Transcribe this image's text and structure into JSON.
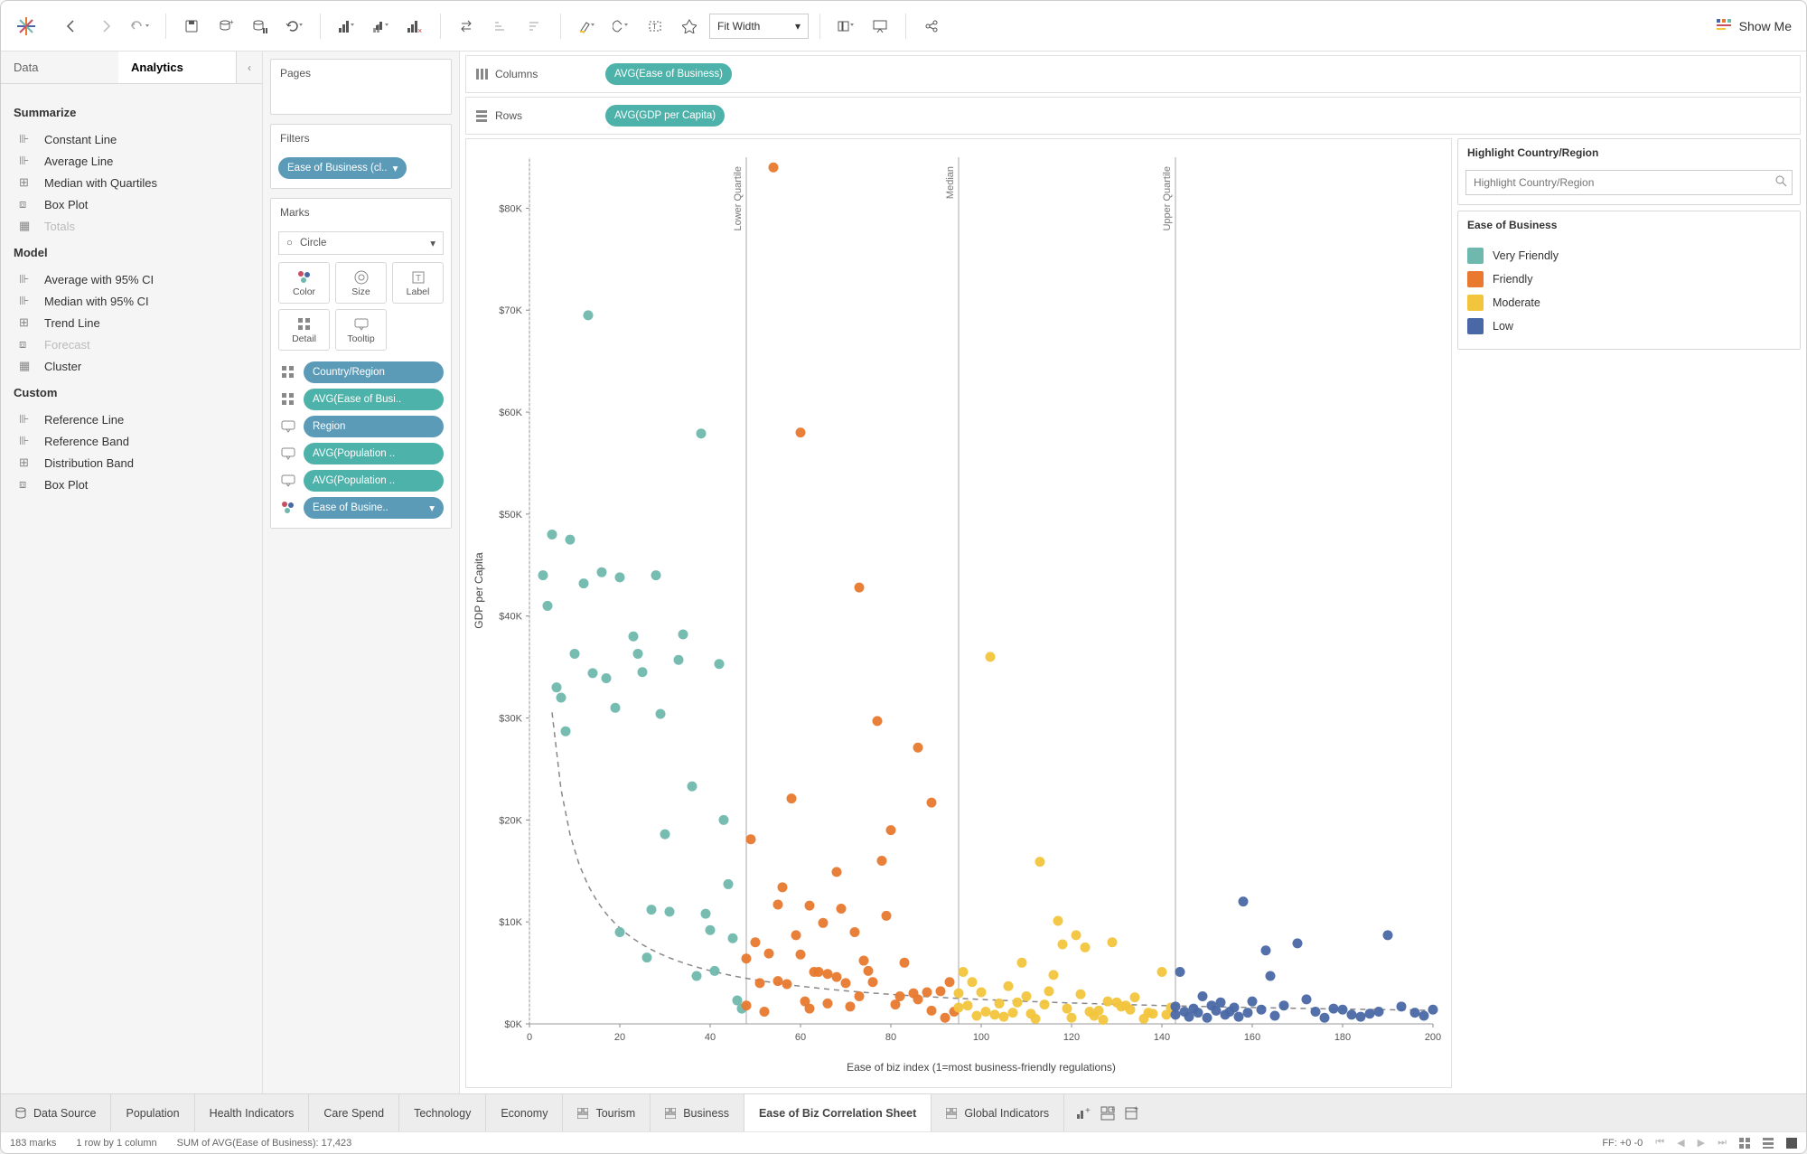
{
  "toolbar": {
    "fit_label": "Fit Width",
    "showme_label": "Show Me"
  },
  "sidebar": {
    "tabs": {
      "data": "Data",
      "analytics": "Analytics"
    },
    "summarize": {
      "heading": "Summarize",
      "items": [
        "Constant Line",
        "Average Line",
        "Median with Quartiles",
        "Box Plot",
        "Totals"
      ]
    },
    "model": {
      "heading": "Model",
      "items": [
        "Average with 95% CI",
        "Median with 95% CI",
        "Trend Line",
        "Forecast",
        "Cluster"
      ]
    },
    "custom": {
      "heading": "Custom",
      "items": [
        "Reference Line",
        "Reference Band",
        "Distribution Band",
        "Box Plot"
      ]
    }
  },
  "mid": {
    "pages": "Pages",
    "filters": "Filters",
    "filters_pill": "Ease of Business (cl..",
    "marks": "Marks",
    "mark_type": "Circle",
    "mark_btns": [
      "Color",
      "Size",
      "Label",
      "Detail",
      "Tooltip"
    ],
    "mark_pills": [
      {
        "pill": "Country/Region",
        "color": "blue",
        "slot": "detail"
      },
      {
        "pill": "AVG(Ease of Busi..",
        "color": "teal",
        "slot": "detail"
      },
      {
        "pill": "Region",
        "color": "blue",
        "slot": "tooltip"
      },
      {
        "pill": "AVG(Population ..",
        "color": "teal",
        "slot": "tooltip"
      },
      {
        "pill": "AVG(Population ..",
        "color": "teal",
        "slot": "tooltip"
      },
      {
        "pill": "Ease of Busine..",
        "color": "blue",
        "slot": "color"
      }
    ]
  },
  "shelves": {
    "columns_label": "Columns",
    "columns_pill": "AVG(Ease of Business)",
    "rows_label": "Rows",
    "rows_pill": "AVG(GDP per Capita)"
  },
  "right": {
    "highlight_heading": "Highlight Country/Region",
    "highlight_placeholder": "Highlight Country/Region",
    "legend_heading": "Ease of Business",
    "legend_items": [
      {
        "label": "Very Friendly",
        "color": "#6fb8ad"
      },
      {
        "label": "Friendly",
        "color": "#e8792e"
      },
      {
        "label": "Moderate",
        "color": "#f2c53d"
      },
      {
        "label": "Low",
        "color": "#4a68a5"
      }
    ]
  },
  "tabs": {
    "data_source": "Data Source",
    "items": [
      "Population",
      "Health Indicators",
      "Care Spend",
      "Technology",
      "Economy",
      "Tourism",
      "Business",
      "Ease of Biz Correlation Sheet",
      "Global Indicators"
    ],
    "active": "Ease of Biz Correlation Sheet"
  },
  "status": {
    "marks": "183 marks",
    "dims": "1 row by 1 column",
    "sum": "SUM of AVG(Ease of Business): 17,423",
    "ff": "FF: +0 -0"
  },
  "chart_data": {
    "type": "scatter",
    "xlabel": "Ease of biz index (1=most business-friendly regulations)",
    "ylabel": "GDP per Capita",
    "xlim": [
      0,
      200
    ],
    "ylim": [
      0,
      85000
    ],
    "xticks": [
      0,
      20,
      40,
      60,
      80,
      100,
      120,
      140,
      160,
      180,
      200
    ],
    "yticks": [
      "$0K",
      "$10K",
      "$20K",
      "$30K",
      "$40K",
      "$50K",
      "$60K",
      "$70K",
      "$80K"
    ],
    "reference_lines": [
      {
        "label": "Lower Quartile",
        "x": 48
      },
      {
        "label": "Median",
        "x": 95
      },
      {
        "label": "Upper Quartile",
        "x": 143
      }
    ],
    "colors": {
      "Very Friendly": "#6fb8ad",
      "Friendly": "#e8792e",
      "Moderate": "#f2c53d",
      "Low": "#4a68a5"
    },
    "series": [
      {
        "name": "Very Friendly",
        "points": [
          [
            3,
            44000
          ],
          [
            4,
            41000
          ],
          [
            5,
            48000
          ],
          [
            6,
            33000
          ],
          [
            7,
            32000
          ],
          [
            8,
            28700
          ],
          [
            9,
            47500
          ],
          [
            10,
            36300
          ],
          [
            12,
            43200
          ],
          [
            13,
            69500
          ],
          [
            14,
            34400
          ],
          [
            16,
            44300
          ],
          [
            17,
            33900
          ],
          [
            20,
            43800
          ],
          [
            19,
            31000
          ],
          [
            20,
            9000
          ],
          [
            23,
            38000
          ],
          [
            24,
            36300
          ],
          [
            25,
            34500
          ],
          [
            26,
            6500
          ],
          [
            27,
            11200
          ],
          [
            28,
            44000
          ],
          [
            29,
            30400
          ],
          [
            30,
            18600
          ],
          [
            31,
            11000
          ],
          [
            33,
            35700
          ],
          [
            34,
            38200
          ],
          [
            36,
            23300
          ],
          [
            37,
            4700
          ],
          [
            38,
            57900
          ],
          [
            39,
            10800
          ],
          [
            40,
            9200
          ],
          [
            41,
            5200
          ],
          [
            42,
            35300
          ],
          [
            43,
            20000
          ],
          [
            44,
            13700
          ],
          [
            45,
            8400
          ],
          [
            46,
            2300
          ],
          [
            47,
            1500
          ]
        ]
      },
      {
        "name": "Friendly",
        "points": [
          [
            48,
            1800
          ],
          [
            48,
            6400
          ],
          [
            49,
            18100
          ],
          [
            50,
            8000
          ],
          [
            51,
            4000
          ],
          [
            52,
            1200
          ],
          [
            53,
            6900
          ],
          [
            54,
            84000
          ],
          [
            55,
            4200
          ],
          [
            55,
            11700
          ],
          [
            56,
            13400
          ],
          [
            57,
            3900
          ],
          [
            58,
            22100
          ],
          [
            59,
            8700
          ],
          [
            60,
            6800
          ],
          [
            60,
            58000
          ],
          [
            61,
            2200
          ],
          [
            62,
            11600
          ],
          [
            62,
            1500
          ],
          [
            63,
            5100
          ],
          [
            64,
            5100
          ],
          [
            65,
            9900
          ],
          [
            66,
            4900
          ],
          [
            66,
            2000
          ],
          [
            68,
            14900
          ],
          [
            68,
            4600
          ],
          [
            69,
            11300
          ],
          [
            70,
            4000
          ],
          [
            71,
            1700
          ],
          [
            72,
            9000
          ],
          [
            73,
            2700
          ],
          [
            73,
            42800
          ],
          [
            74,
            6200
          ],
          [
            75,
            5200
          ],
          [
            76,
            4100
          ],
          [
            77,
            29700
          ],
          [
            78,
            16000
          ],
          [
            79,
            10600
          ],
          [
            80,
            19000
          ],
          [
            81,
            1900
          ],
          [
            82,
            2700
          ],
          [
            83,
            6000
          ],
          [
            85,
            3000
          ],
          [
            86,
            27100
          ],
          [
            86,
            2400
          ],
          [
            88,
            3100
          ],
          [
            89,
            21700
          ],
          [
            89,
            1300
          ],
          [
            91,
            3200
          ],
          [
            92,
            600
          ],
          [
            93,
            4100
          ],
          [
            94,
            1200
          ]
        ]
      },
      {
        "name": "Moderate",
        "points": [
          [
            95,
            3000
          ],
          [
            95,
            1600
          ],
          [
            96,
            5100
          ],
          [
            97,
            1800
          ],
          [
            98,
            4100
          ],
          [
            99,
            800
          ],
          [
            100,
            3100
          ],
          [
            101,
            1200
          ],
          [
            102,
            36000
          ],
          [
            103,
            900
          ],
          [
            104,
            2000
          ],
          [
            105,
            700
          ],
          [
            106,
            3700
          ],
          [
            107,
            1100
          ],
          [
            108,
            2100
          ],
          [
            109,
            6000
          ],
          [
            110,
            2700
          ],
          [
            111,
            1000
          ],
          [
            112,
            500
          ],
          [
            113,
            15900
          ],
          [
            114,
            1900
          ],
          [
            115,
            3200
          ],
          [
            116,
            4800
          ],
          [
            117,
            10100
          ],
          [
            118,
            7800
          ],
          [
            119,
            1500
          ],
          [
            120,
            600
          ],
          [
            121,
            8700
          ],
          [
            122,
            2900
          ],
          [
            123,
            7500
          ],
          [
            124,
            1200
          ],
          [
            125,
            800
          ],
          [
            126,
            1300
          ],
          [
            127,
            400
          ],
          [
            128,
            2200
          ],
          [
            129,
            8000
          ],
          [
            130,
            2100
          ],
          [
            131,
            1700
          ],
          [
            132,
            1800
          ],
          [
            133,
            1400
          ],
          [
            134,
            2600
          ],
          [
            136,
            500
          ],
          [
            137,
            1100
          ],
          [
            138,
            1000
          ],
          [
            140,
            5100
          ],
          [
            141,
            900
          ],
          [
            142,
            1600
          ]
        ]
      },
      {
        "name": "Low",
        "points": [
          [
            143,
            900
          ],
          [
            143,
            1700
          ],
          [
            144,
            5100
          ],
          [
            145,
            1200
          ],
          [
            146,
            700
          ],
          [
            147,
            1500
          ],
          [
            148,
            1100
          ],
          [
            149,
            2700
          ],
          [
            150,
            600
          ],
          [
            151,
            1800
          ],
          [
            152,
            1300
          ],
          [
            153,
            2100
          ],
          [
            154,
            900
          ],
          [
            155,
            1200
          ],
          [
            156,
            1600
          ],
          [
            157,
            700
          ],
          [
            158,
            12000
          ],
          [
            159,
            1100
          ],
          [
            160,
            2200
          ],
          [
            162,
            1400
          ],
          [
            163,
            7200
          ],
          [
            164,
            4700
          ],
          [
            165,
            800
          ],
          [
            167,
            1800
          ],
          [
            170,
            7900
          ],
          [
            172,
            2400
          ],
          [
            174,
            1200
          ],
          [
            176,
            600
          ],
          [
            178,
            1500
          ],
          [
            180,
            1400
          ],
          [
            182,
            900
          ],
          [
            184,
            700
          ],
          [
            186,
            1000
          ],
          [
            188,
            1200
          ],
          [
            190,
            8700
          ],
          [
            193,
            1700
          ],
          [
            196,
            1100
          ],
          [
            198,
            800
          ],
          [
            200,
            1400
          ]
        ]
      }
    ],
    "trend": "power"
  }
}
